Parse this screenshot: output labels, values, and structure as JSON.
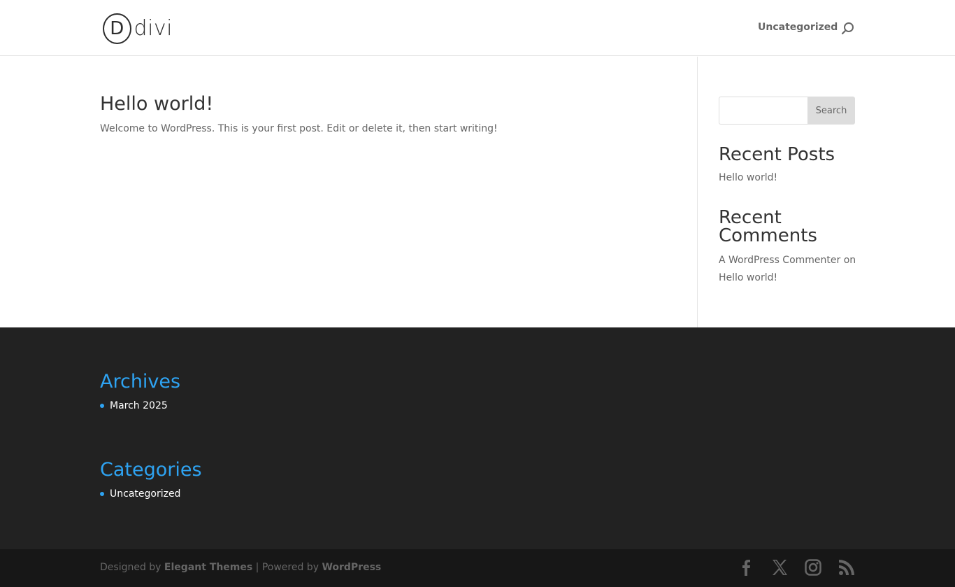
{
  "header": {
    "logo_letter": "D",
    "logo_text": "divi",
    "nav_items": [
      "Uncategorized"
    ],
    "search_icon": "search-icon"
  },
  "post": {
    "title": "Hello world!",
    "excerpt": "Welcome to WordPress. This is your first post. Edit or delete it, then start writing!"
  },
  "sidebar": {
    "search_button_label": "Search",
    "search_input_value": "",
    "recent_posts_title": "Recent Posts",
    "recent_posts": [
      "Hello world!"
    ],
    "recent_comments_title": "Recent Comments",
    "recent_comment": {
      "author": "A WordPress Commenter",
      "connector": "on",
      "post": "Hello world!"
    }
  },
  "footer": {
    "archives_title": "Archives",
    "archives": [
      "March 2025"
    ],
    "categories_title": "Categories",
    "categories": [
      "Uncategorized"
    ]
  },
  "bottom": {
    "designed_by_prefix": "Designed by",
    "designer": "Elegant Themes",
    "separator": "| Powered by",
    "platform": "WordPress",
    "social_icons": [
      "facebook-icon",
      "x-icon",
      "instagram-icon",
      "rss-icon"
    ]
  },
  "colors": {
    "accent": "#2ea3f2",
    "footer_bg": "#222222",
    "bottom_bg": "#171717"
  }
}
